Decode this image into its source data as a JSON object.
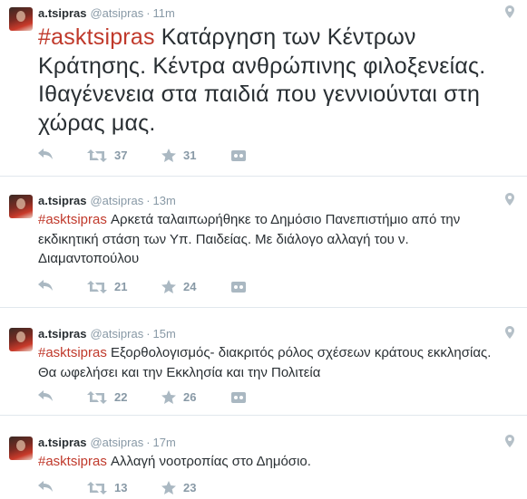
{
  "tweets": [
    {
      "name": "a.tsipras",
      "handle": "@atsipras",
      "dot": "·",
      "time": "11m",
      "hashtag": "#asktsipras",
      "text": " Κατάργηση των Κέντρων Κράτησης. Κέντρα ανθρώπινης φιλοξενείας. Ιθαγένενεια στα παιδιά που γεννιούνται στη χώρας μας.",
      "retweets": "37",
      "favorites": "31"
    },
    {
      "name": "a.tsipras",
      "handle": "@atsipras",
      "dot": "·",
      "time": "13m",
      "hashtag": "#asktsipras",
      "text": " Αρκετά ταλαιπωρήθηκε το Δημόσιο Πανεπιστήμιο από την εκδικητική στάση των Υπ. Παιδείας. Με διάλογο αλλαγή του ν. Διαμαντοπούλου",
      "retweets": "21",
      "favorites": "24"
    },
    {
      "name": "a.tsipras",
      "handle": "@atsipras",
      "dot": "·",
      "time": "15m",
      "hashtag": "#asktsipras",
      "text": " Εξορθολογισμός- διακριτός ρόλος σχέσεων κράτους εκκλησίας. Θα ωφελήσει και την Εκκλησία και την Πολιτεία",
      "retweets": "22",
      "favorites": "26"
    },
    {
      "name": "a.tsipras",
      "handle": "@atsipras",
      "dot": "·",
      "time": "17m",
      "hashtag": "#asktsipras",
      "text": " Αλλαγή νοοτροπίας στο Δημόσιο.",
      "retweets": "13",
      "favorites": "23"
    }
  ],
  "icons": {
    "reply": "reply-icon",
    "retweet": "retweet-icon",
    "favorite": "star-icon",
    "more": "more-icon",
    "geo": "location-pin-icon"
  },
  "colors": {
    "hashtag": "#c0392b",
    "meta": "#8899a6",
    "text": "#292f33"
  }
}
